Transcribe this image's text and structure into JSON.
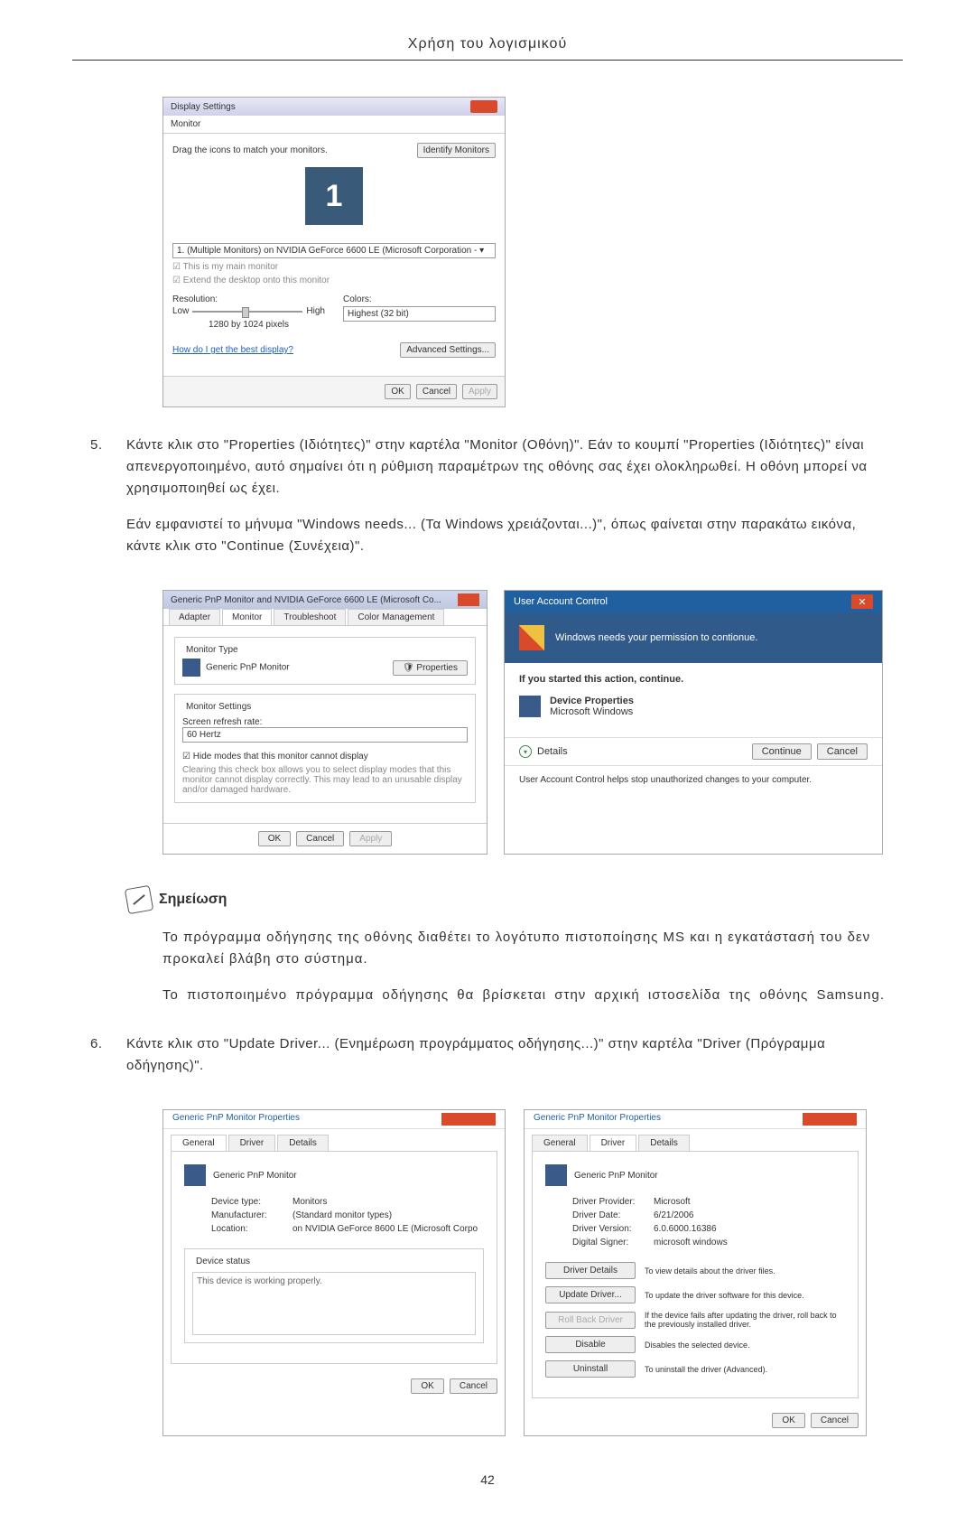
{
  "header": "Χρήση του λογισμικού",
  "displaySettings": {
    "title": "Display Settings",
    "tab": "Monitor",
    "dragText": "Drag the icons to match your monitors.",
    "identifyBtn": "Identify Monitors",
    "monitorNum": "1",
    "combo": "1. (Multiple Monitors) on NVIDIA GeForce 6600 LE (Microsoft Corporation -  ▾",
    "check1": "This is my main monitor",
    "check2": "Extend the desktop onto this monitor",
    "resLabel": "Resolution:",
    "lowText": "Low",
    "highText": "High",
    "resValue": "1280 by 1024 pixels",
    "colorsLabel": "Colors:",
    "colorsValue": "Highest (32 bit)",
    "helpLink": "How do I get the best display?",
    "advBtn": "Advanced Settings...",
    "okBtn": "OK",
    "cancelBtn": "Cancel",
    "applyBtn": "Apply"
  },
  "step5": {
    "num": "5.",
    "para1": "Κάντε κλικ στο \"Properties (Ιδιότητες)\" στην καρτέλα \"Monitor (Οθόνη)\". Εάν το κουμπί \"Properties (Ιδιότητες)\" είναι απενεργοποιημένο, αυτό σημαίνει ότι η ρύθμιση παραμέτρων της οθόνης σας έχει ολοκληρωθεί. Η οθόνη μπορεί να χρησιμοποιηθεί ως έχει.",
    "para2": "Εάν εμφανιστεί το μήνυμα \"Windows needs... (Τα Windows χρειάζονται...)\", όπως φαίνεται στην παρακάτω εικόνα, κάντε κλικ στο \"Continue (Συνέχεια)\"."
  },
  "monitorDialog": {
    "title": "Generic PnP Monitor and NVIDIA GeForce 6600 LE (Microsoft Co...",
    "tabs": [
      "Adapter",
      "Monitor",
      "Troubleshoot",
      "Color Management"
    ],
    "groupType": "Monitor Type",
    "monitorName": "Generic PnP Monitor",
    "propBtn": "Properties",
    "groupSettings": "Monitor Settings",
    "refreshLabel": "Screen refresh rate:",
    "refreshValue": "60 Hertz",
    "hideCheck": "Hide modes that this monitor cannot display",
    "hideText": "Clearing this check box allows you to select display modes that this monitor cannot display correctly. This may lead to an unusable display and/or damaged hardware.",
    "okBtn": "OK",
    "cancelBtn": "Cancel",
    "applyBtn": "Apply"
  },
  "uac": {
    "title": "User Account Control",
    "banner": "Windows needs your permission to contionue.",
    "subtitle": "If you started this action, continue.",
    "devProp": "Device Properties",
    "msWin": "Microsoft Windows",
    "details": "Details",
    "continueBtn": "Continue",
    "cancelBtn": "Cancel",
    "noteText": "User Account Control helps stop unauthorized changes to your computer."
  },
  "note": {
    "label": "Σημείωση",
    "para1": "Το πρόγραμμα οδήγησης της οθόνης διαθέτει το λογότυπο πιστοποίησης MS και η εγκατάστασή του δεν προκαλεί βλάβη στο σύστημα.",
    "para2": "Το πιστοποιημένο πρόγραμμα οδήγησης θα βρίσκεται στην αρχική ιστοσελίδα της οθόνης Samsung."
  },
  "step6": {
    "num": "6.",
    "text": "Κάντε κλικ στο \"Update Driver... (Ενημέρωση προγράμματος οδήγησης...)\" στην καρτέλα \"Driver (Πρόγραμμα οδήγησης)\"."
  },
  "propGeneral": {
    "title": "Generic PnP Monitor Properties",
    "tabs": [
      "General",
      "Driver",
      "Details"
    ],
    "name": "Generic PnP Monitor",
    "devTypeLabel": "Device type:",
    "devTypeVal": "Monitors",
    "mfgLabel": "Manufacturer:",
    "mfgVal": "(Standard monitor types)",
    "locLabel": "Location:",
    "locVal": "on NVIDIA GeForce 8600 LE (Microsoft Corpo",
    "statusLabel": "Device status",
    "statusText": "This device is working properly.",
    "okBtn": "OK",
    "cancelBtn": "Cancel"
  },
  "propDriver": {
    "title": "Generic PnP Monitor Properties",
    "name": "Generic PnP Monitor",
    "provLabel": "Driver Provider:",
    "provVal": "Microsoft",
    "dateLabel": "Driver Date:",
    "dateVal": "6/21/2006",
    "verLabel": "Driver Version:",
    "verVal": "6.0.6000.16386",
    "signerLabel": "Digital Signer:",
    "signerVal": "microsoft windows",
    "btnDetails": "Driver Details",
    "txtDetails": "To view details about the driver files.",
    "btnUpdate": "Update Driver...",
    "txtUpdate": "To update the driver software for this device.",
    "btnRoll": "Roll Back Driver",
    "txtRoll": "If the device fails after updating the driver, roll back to the previously installed driver.",
    "btnDisable": "Disable",
    "txtDisable": "Disables the selected device.",
    "btnUninstall": "Uninstall",
    "txtUninstall": "To uninstall the driver (Advanced).",
    "okBtn": "OK",
    "cancelBtn": "Cancel"
  },
  "pageNum": "42"
}
